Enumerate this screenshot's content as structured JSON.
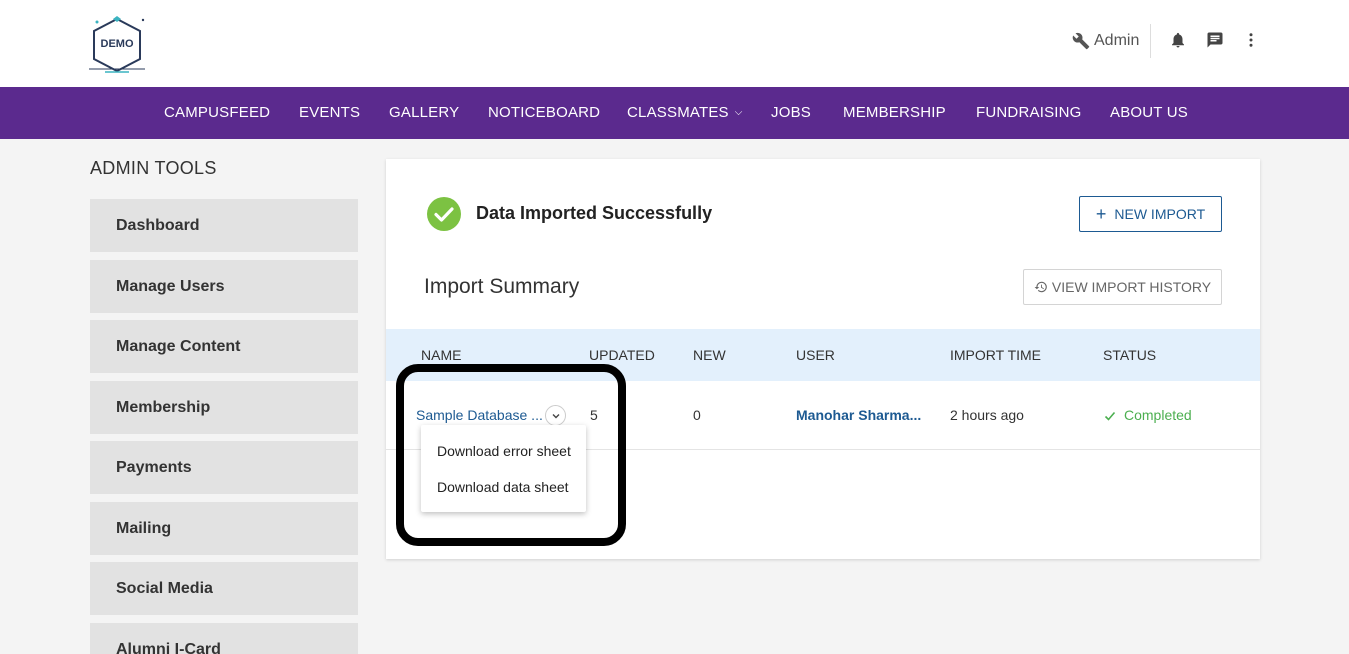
{
  "logo": {
    "text": "DEMO"
  },
  "header": {
    "admin_label": "Admin",
    "icons": [
      "wrench-icon",
      "bell-icon",
      "chat-icon",
      "more-vert-icon"
    ]
  },
  "nav": {
    "items": [
      "CAMPUSFEED",
      "EVENTS",
      "GALLERY",
      "NOTICEBOARD",
      "CLASSMATES",
      "JOBS",
      "MEMBERSHIP",
      "FUNDRAISING",
      "ABOUT US"
    ]
  },
  "sidebar": {
    "title": "ADMIN TOOLS",
    "items": [
      "Dashboard",
      "Manage Users",
      "Manage Content",
      "Membership",
      "Payments",
      "Mailing",
      "Social Media",
      "Alumni I-Card"
    ]
  },
  "content": {
    "success_message": "Data Imported Successfully",
    "new_import_label": "NEW IMPORT",
    "summary_title": "Import Summary",
    "history_label": "VIEW IMPORT HISTORY",
    "table": {
      "headers": [
        "NAME",
        "UPDATED",
        "NEW",
        "USER",
        "IMPORT TIME",
        "STATUS"
      ],
      "rows": [
        {
          "name": "Sample Database ...",
          "updated": "5",
          "new": "0",
          "user": "Manohar Sharma...",
          "import_time": "2 hours ago",
          "status": "Completed"
        }
      ]
    },
    "dropdown": [
      "Download error sheet",
      "Download data sheet"
    ]
  },
  "colors": {
    "nav_bg": "#5b2a8e",
    "accent_blue": "#1d5a92",
    "success_green": "#7cc242",
    "status_green": "#4caf50",
    "table_head_bg": "#e3f0fc"
  }
}
